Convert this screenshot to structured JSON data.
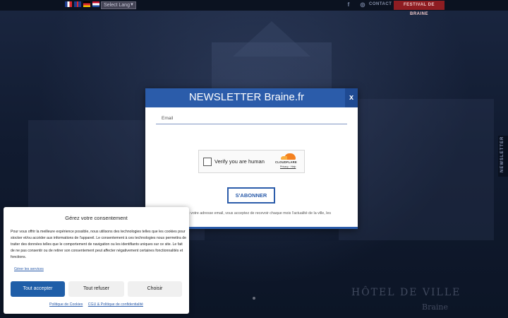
{
  "topbar": {
    "language_select": "Select Lang",
    "contact_label": "CONTACT",
    "festival_label": "FESTIVAL DE BRAINE",
    "icons": [
      "facebook-icon",
      "instagram-icon"
    ]
  },
  "background": {
    "subtitle_line1": "HÔTEL DE VILLE",
    "subtitle_line2": "Braine"
  },
  "side_tab": {
    "label": "NEWSLETTER"
  },
  "newsletter": {
    "title": "NEWSLETTER Braine.fr",
    "close_label": "x",
    "email_placeholder": "Email",
    "captcha_label": "Verify you are human",
    "captcha_brand": "CLOUDFLARE",
    "captcha_links": "Privacy · Help",
    "subscribe_label": "S'ABONNER",
    "disclaimer": "En renseignant votre adresse email, vous acceptez de recevoir chaque mois l'actualité de la ville, les"
  },
  "consent": {
    "title": "Gérez votre consentement",
    "body": "Pour vous offrir la meilleure expérience possible, nous utilisons des technologies telles que les cookies pour stocker et/ou accéder aux informations de l'appareil. Le consentement à ces technologies nous permettra de traiter des données telles que le comportement de navigation ou les identifiants uniques sur ce site. Le fait de ne pas consentir ou de retirer son consentement peut affecter négativement certaines fonctionnalités et fonctions.",
    "manage_link": "Gérer les services",
    "accept_label": "Tout accepter",
    "refuse_label": "Tout refuser",
    "choose_label": "Choisir",
    "cookie_policy_link": "Politique de Cookies",
    "privacy_link": "CGU & Politique de confidentialité"
  },
  "colors": {
    "brand_blue": "#2b5caa",
    "festival_red": "#8e1d22",
    "accept_blue": "#1f5ea8"
  }
}
